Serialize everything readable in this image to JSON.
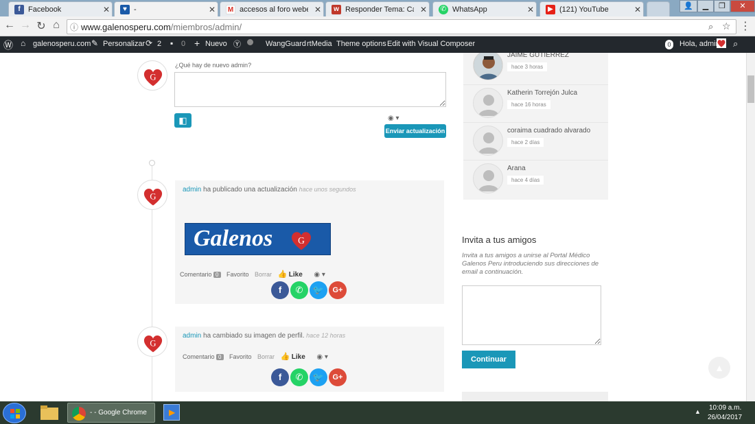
{
  "browser": {
    "tabs": [
      {
        "title": "Facebook",
        "icon": "facebook-icon",
        "color": "#3b5998"
      },
      {
        "title": "-",
        "icon": "galenos-icon",
        "color": "#1a5aa8"
      },
      {
        "title": "accesos al foro webempr",
        "icon": "gmail-icon",
        "color": "#d93025"
      },
      {
        "title": "Responder Tema: Cambi",
        "icon": "wordfence-icon",
        "color": "#c0392b"
      },
      {
        "title": "WhatsApp",
        "icon": "whatsapp-icon",
        "color": "#25d366"
      },
      {
        "title": "(121) YouTube",
        "icon": "youtube-icon",
        "color": "#e62117"
      }
    ],
    "url_host": "www.galenosperu.com",
    "url_path": "/miembros/admin/"
  },
  "adminbar": {
    "site": "galenosperu.com",
    "customize": "Personalizar",
    "updates": "2",
    "comments": "0",
    "new": "Nuevo",
    "wangguard": "WangGuard",
    "rtmedia": "rtMedia",
    "theme_options": "Theme options",
    "visual_composer": "Edit with Visual Composer",
    "notif_count": "0",
    "greeting": "Hola, admin"
  },
  "post_form": {
    "placeholder": "¿Qué hay de nuevo admin?",
    "submit": "Enviar actualización"
  },
  "activities": [
    {
      "user": "admin",
      "action": "ha publicado una actualización",
      "time": "hace unos segundos",
      "image_text": "Galenos",
      "comment_label": "Comentario",
      "comment_count": "0",
      "fav_label": "Favorito",
      "delete_label": "Borrar",
      "like_label": "Like"
    },
    {
      "user": "admin",
      "action": "ha cambiado su imagen de perfil.",
      "time": "hace 12 horas",
      "comment_label": "Comentario",
      "comment_count": "0",
      "fav_label": "Favorito",
      "delete_label": "Borrar",
      "like_label": "Like"
    }
  ],
  "members": [
    {
      "name": "JAIME GUTIERREZ",
      "time": "hace 3 horas"
    },
    {
      "name": "Katherin Torrejón Julca",
      "time": "hace 16 horas"
    },
    {
      "name": "coraima cuadrado alvarado",
      "time": "hace 2 días"
    },
    {
      "name": "Arana",
      "time": "hace 4 días"
    }
  ],
  "invite": {
    "title": "Invita a tus amigos",
    "description": "Invita a tus amigos a unirse al Portal Médico Galenos Peru introduciendo sus direcciones de email a continuación.",
    "button": "Continuar"
  },
  "taskbar": {
    "chrome_label": "- - Google Chrome",
    "time": "10:09 a.m.",
    "date": "26/04/2017"
  },
  "colors": {
    "accent": "#1a97b8",
    "adminbar": "#23282d"
  }
}
